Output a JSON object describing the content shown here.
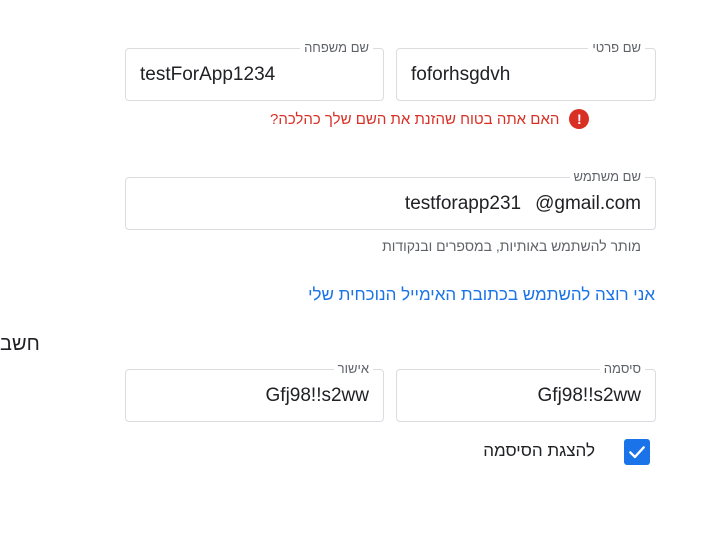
{
  "last_name": {
    "label": "שם משפחה",
    "value": "testForApp1234"
  },
  "first_name": {
    "label": "שם פרטי",
    "value": "foforhsgdvh"
  },
  "name_warning": {
    "icon": "error-icon",
    "glyph": "!",
    "text": "האם אתה בטוח שהזנת את השם שלך כהלכה?"
  },
  "username": {
    "label": "שם משתמש",
    "value": "testforapp231",
    "suffix": "@gmail.com",
    "helper": "מותר להשתמש באותיות, במספרים ובנקודות"
  },
  "use_existing_email_link": "אני רוצה להשתמש בכתובת האימייל הנוכחית שלי",
  "side_label": "חשב",
  "confirm_password": {
    "label": "אישור",
    "value": "Gfj98!!s2ww"
  },
  "password": {
    "label": "סיסמה",
    "value": "Gfj98!!s2ww"
  },
  "show_password": {
    "label": "להצגת הסיסמה",
    "checked": true
  },
  "colors": {
    "accent": "#1a73e8",
    "error": "#d93025",
    "border": "#dadce0"
  }
}
